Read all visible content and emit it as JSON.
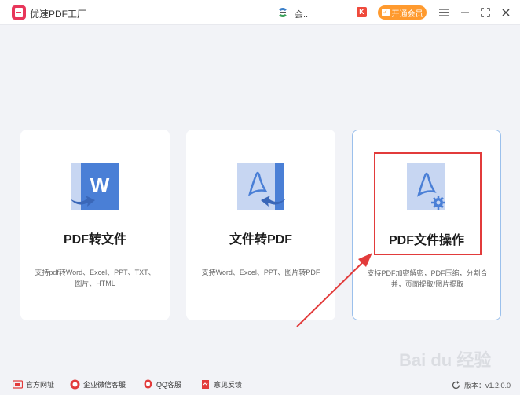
{
  "app": {
    "title": "优速PDF工厂",
    "user_name": "会..",
    "vip_button_label": "开通会员",
    "vip_mini_label": "K"
  },
  "cards": [
    {
      "title": "PDF转文件",
      "desc": "支持pdf转Word、Excel、PPT、TXT、图片、HTML",
      "icon": "pdf-to-word-icon"
    },
    {
      "title": "文件转PDF",
      "desc": "支持Word、Excel、PPT、图片转PDF",
      "icon": "file-to-pdf-icon"
    },
    {
      "title": "PDF文件操作",
      "desc": "支持PDF加密解密，PDF压缩，分割合并，页面提取/图片提取",
      "icon": "pdf-settings-icon"
    }
  ],
  "footer": {
    "items": [
      {
        "label": "官方网址",
        "icon": "website-icon"
      },
      {
        "label": "企业微信客服",
        "icon": "wechat-service-icon"
      },
      {
        "label": "QQ客服",
        "icon": "qq-icon"
      },
      {
        "label": "意见反馈",
        "icon": "feedback-icon"
      }
    ],
    "version": "版本：v1.2.0.0"
  },
  "watermark": "Bai du 经验",
  "colors": {
    "accent_blue": "#4a7fd6",
    "highlight_red": "#e23b3b",
    "vip_orange": "#ff9a2e",
    "logo_red": "#e8365a"
  }
}
